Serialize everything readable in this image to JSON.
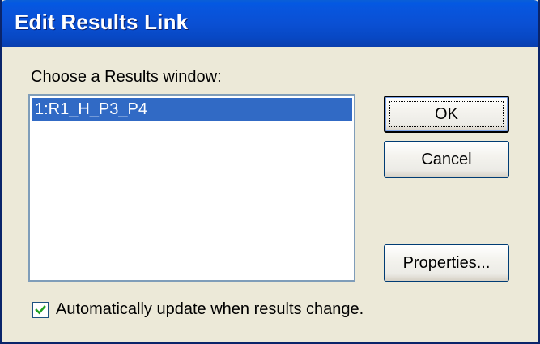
{
  "dialog": {
    "title": "Edit Results Link",
    "choose_label": "Choose a Results window:",
    "results_list": {
      "items": [
        "1:R1_H_P3_P4"
      ],
      "selected_index": 0
    },
    "buttons": {
      "ok": "OK",
      "cancel": "Cancel",
      "properties": "Properties..."
    },
    "auto_update": {
      "label": "Automatically update when results change.",
      "checked": true
    }
  },
  "colors": {
    "titlebar": "#0A50D4",
    "selection": "#316AC5",
    "dialog_bg": "#ECE9D8"
  }
}
